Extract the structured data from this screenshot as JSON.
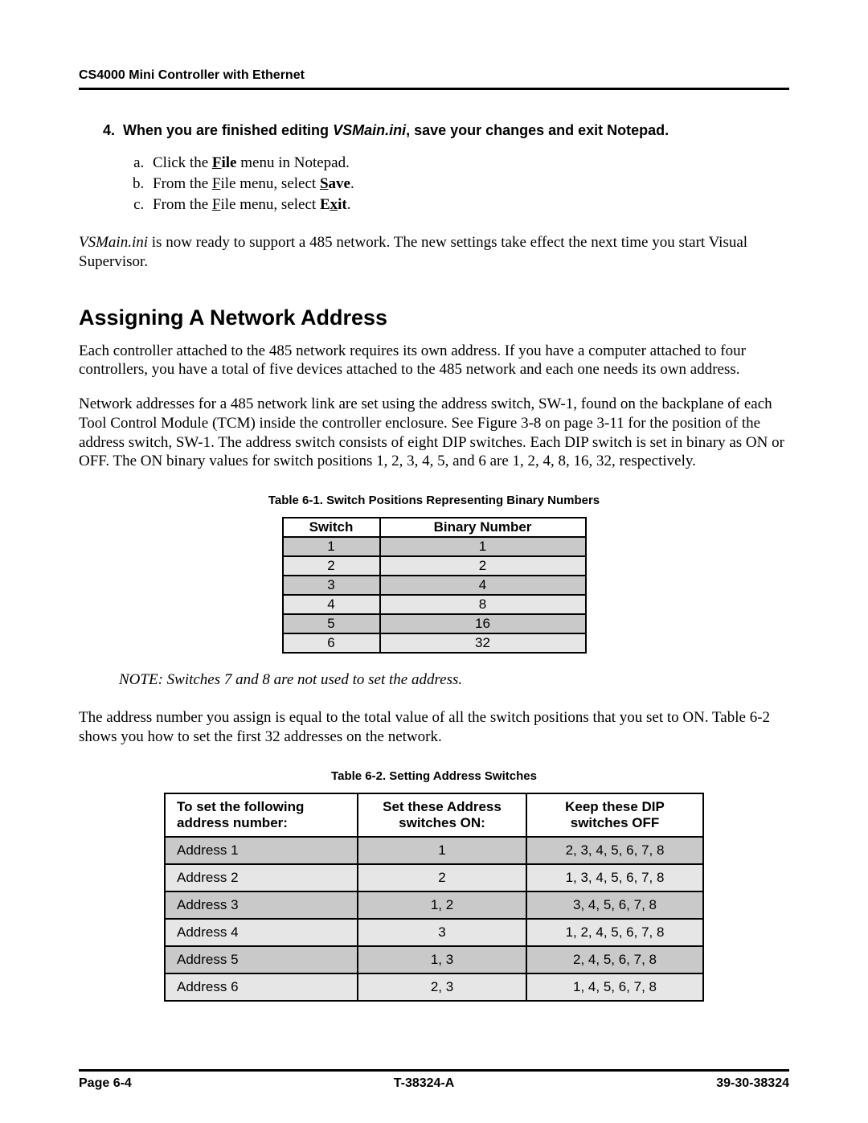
{
  "running_head": "CS4000 Mini Controller with Ethernet",
  "step4_prefix": "4.",
  "step4_lead": "When you are finished editing ",
  "step4_file": "VSMain.ini",
  "step4_tail": ", save your changes and exit Notepad.",
  "sub_a_1": "Click the ",
  "sub_a_u": "F",
  "sub_a_2": "ile",
  "sub_a_3": " menu in Notepad.",
  "sub_b_1": "From the ",
  "sub_b_u": "F",
  "sub_b_2": "ile menu, select ",
  "sub_b_su": "S",
  "sub_b_3": "ave",
  "sub_b_4": ".",
  "sub_c_1": "From the ",
  "sub_c_u": "F",
  "sub_c_2": "ile menu, select ",
  "sub_c_eu": "x",
  "sub_c_e1": "E",
  "sub_c_e2": "it",
  "sub_c_4": ".",
  "para1_a": "VSMain.ini",
  "para1_b": " is now ready to support a 485 network. The new settings take effect the next time you start Visual Supervisor.",
  "h2": "Assigning A Network Address",
  "para2": "Each controller attached to the 485 network requires its own address. If you have a computer attached to four controllers, you have a total of five devices attached to the 485 network and each one needs its own address.",
  "para3": "Network addresses for a 485 network link are set using the address switch, SW-1, found on the backplane of each Tool Control Module (TCM) inside the controller enclosure. See Figure 3-8 on page 3-11 for the position of the address switch, SW-1. The address switch consists of eight DIP switches. Each DIP switch is set in binary as ON or OFF. The ON binary values for switch positions 1, 2, 3, 4, 5, and 6 are 1, 2, 4, 8, 16, 32, respectively.",
  "caption1": "Table 6-1.   Switch Positions Representing Binary Numbers",
  "t1_h1": "Switch",
  "t1_h2": "Binary Number",
  "t1_rows": [
    {
      "s": "1",
      "b": "1"
    },
    {
      "s": "2",
      "b": "2"
    },
    {
      "s": "3",
      "b": "4"
    },
    {
      "s": "4",
      "b": "8"
    },
    {
      "s": "5",
      "b": "16"
    },
    {
      "s": "6",
      "b": "32"
    }
  ],
  "note": "NOTE:  Switches 7 and 8 are not used to set the address.",
  "para4": "The address number you assign is equal to the total value of all the switch positions that you set to ON. Table 6-2 shows you how to set the first 32 addresses on the network.",
  "caption2": "Table 6-2.   Setting Address Switches",
  "t2_h1a": "To set the following",
  "t2_h1b": "address number:",
  "t2_h2a": "Set these Address",
  "t2_h2b": "switches ON:",
  "t2_h3a": "Keep these DIP",
  "t2_h3b": "switches OFF",
  "t2_rows": [
    {
      "a": "Address 1",
      "on": "1",
      "off": "2, 3, 4, 5, 6, 7, 8"
    },
    {
      "a": "Address 2",
      "on": "2",
      "off": "1, 3, 4, 5, 6, 7, 8"
    },
    {
      "a": "Address 3",
      "on": "1, 2",
      "off": "3, 4, 5, 6, 7, 8"
    },
    {
      "a": "Address 4",
      "on": "3",
      "off": "1, 2, 4, 5, 6, 7, 8"
    },
    {
      "a": "Address 5",
      "on": "1, 3",
      "off": "2, 4, 5, 6, 7, 8"
    },
    {
      "a": "Address 6",
      "on": "2, 3",
      "off": "1, 4, 5, 6, 7, 8"
    }
  ],
  "footer_left": "Page 6-4",
  "footer_mid": "T-38324-A",
  "footer_right": "39-30-38324"
}
